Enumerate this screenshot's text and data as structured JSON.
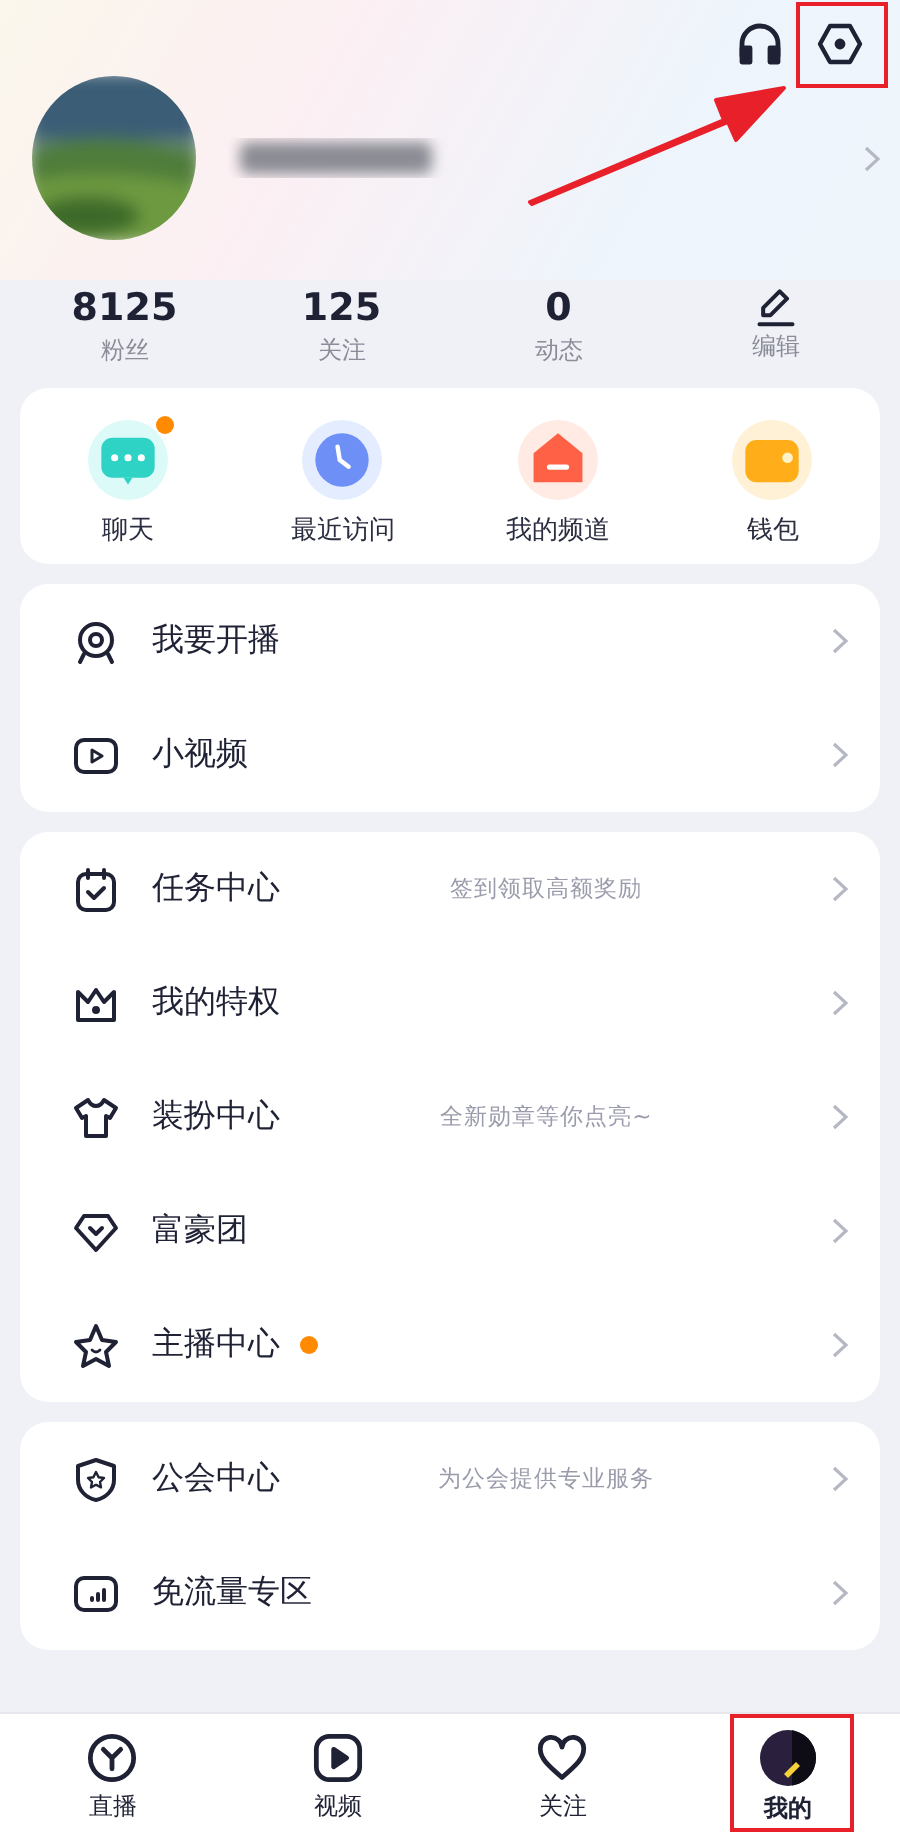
{
  "stats": [
    {
      "value": "8125",
      "label": "粉丝"
    },
    {
      "value": "125",
      "label": "关注"
    },
    {
      "value": "0",
      "label": "动态"
    }
  ],
  "edit": {
    "label": "编辑"
  },
  "shortcuts": [
    {
      "label": "聊天",
      "dot": true
    },
    {
      "label": "最近访问",
      "dot": false
    },
    {
      "label": "我的频道",
      "dot": false
    },
    {
      "label": "钱包",
      "dot": false
    }
  ],
  "groups": [
    {
      "items": [
        {
          "label": "我要开播",
          "dot": false
        },
        {
          "label": "小视频",
          "dot": false
        }
      ]
    },
    {
      "items": [
        {
          "label": "任务中心",
          "hint": "签到领取高额奖励",
          "dot": false
        },
        {
          "label": "我的特权",
          "dot": false
        },
        {
          "label": "装扮中心",
          "hint": "全新勋章等你点亮~",
          "dot": false
        },
        {
          "label": "富豪团",
          "dot": false
        },
        {
          "label": "主播中心",
          "dot": true
        }
      ]
    },
    {
      "items": [
        {
          "label": "公会中心",
          "hint": "为公会提供专业服务",
          "dot": false
        },
        {
          "label": "免流量专区",
          "dot": false
        }
      ]
    }
  ],
  "tabs": [
    {
      "label": "直播",
      "selected": false
    },
    {
      "label": "视频",
      "selected": false
    },
    {
      "label": "关注",
      "selected": false
    },
    {
      "label": "我的",
      "selected": true
    }
  ]
}
